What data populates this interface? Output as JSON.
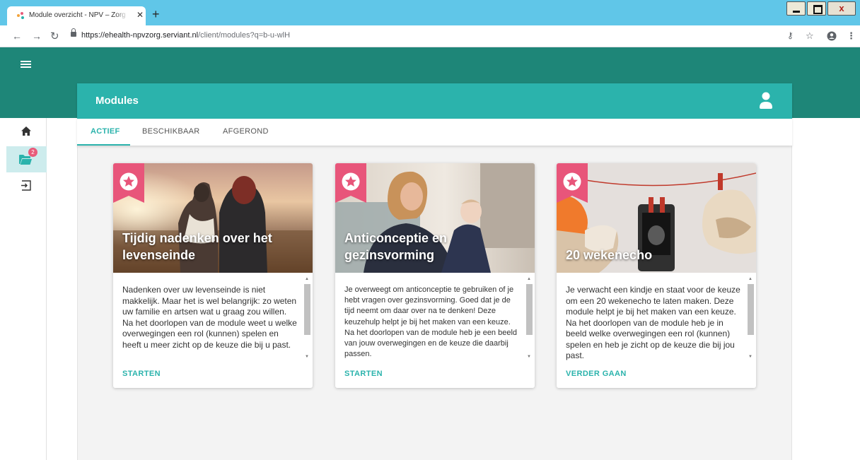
{
  "browser": {
    "tab_title": "Module overzicht - NPV – Zorg voor elkaar",
    "tab_close": "✕",
    "new_tab": "+",
    "url_host": "https://ehealth-npvzorg.serviant.nl",
    "url_path": "/client/modules?q=b-u-wlH",
    "window_close": "x"
  },
  "app": {
    "header_title": "Modules",
    "colors": {
      "header": "#1e8678",
      "accent": "#2bb3ac",
      "badge": "#e85b7a",
      "favorite": "#e8557a"
    }
  },
  "sidebar": {
    "items": [
      {
        "name": "home",
        "icon": "home-icon"
      },
      {
        "name": "modules",
        "icon": "folder-open-icon",
        "badge": "2",
        "active": true
      },
      {
        "name": "logout",
        "icon": "logout-icon"
      }
    ]
  },
  "tabs": [
    {
      "label": "ACTIEF",
      "active": true
    },
    {
      "label": "BESCHIKBAAR"
    },
    {
      "label": "AFGEROND"
    }
  ],
  "cards": [
    {
      "title": "Tijdig nadenken over het levenseinde",
      "description": "Nadenken over uw levenseinde is niet makkelijk. Maar het is wel belangrijk: zo weten uw familie en artsen wat u graag zou willen. Na het doorlopen van de module weet u welke overwegingen een rol (kunnen) spelen en heeft u meer zicht op de keuze die bij u past.",
      "action": "STARTEN"
    },
    {
      "title": "Anticonceptie en gezinsvorming",
      "description": "Je overweegt om anticonceptie te gebruiken of je hebt vragen over gezinsvorming. Goed dat je de tijd neemt om daar over na te denken! Deze keuzehulp helpt je bij het maken van een keuze. Na het doorlopen van de module heb je een beeld van jouw overwegingen en de keuze die daarbij passen.",
      "action": "STARTEN"
    },
    {
      "title": "20 wekenecho",
      "description": "Je verwacht een kindje en staat voor de keuze om een 20 wekenecho te laten maken. Deze module helpt je bij het maken van een keuze. Na het doorlopen van de module heb je in beeld welke overwegingen een rol (kunnen) spelen en heb je zicht op de keuze die bij jou past.",
      "action": "VERDER GAAN"
    }
  ]
}
